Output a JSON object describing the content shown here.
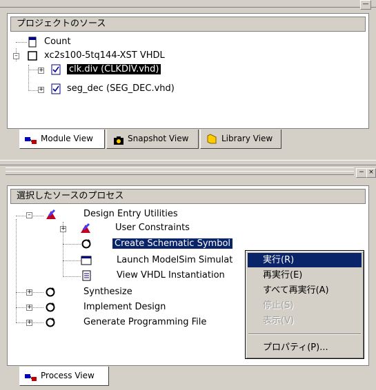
{
  "sources_panel": {
    "header": "プロジェクトのソース",
    "items": [
      {
        "label": "Count"
      },
      {
        "label": "xc2s100-5tq144-XST VHDL"
      },
      {
        "label": "clk.div (CLKDIV.vhd)"
      },
      {
        "label": "seg_dec (SEG_DEC.vhd)"
      }
    ]
  },
  "sources_tabs": [
    {
      "label": "Module View"
    },
    {
      "label": "Snapshot View"
    },
    {
      "label": "Library View"
    }
  ],
  "process_panel": {
    "header": "選択したソースのプロセス",
    "items": [
      {
        "label": "Design Entry Utilities"
      },
      {
        "label": "User Constraints"
      },
      {
        "label": "Create Schematic Symbol"
      },
      {
        "label": "Launch ModelSim Simulat"
      },
      {
        "label": "View VHDL Instantiation"
      },
      {
        "label": "Synthesize"
      },
      {
        "label": "Implement Design"
      },
      {
        "label": "Generate Programming File"
      }
    ]
  },
  "process_tabs": [
    {
      "label": "Process View"
    }
  ],
  "context_menu": {
    "items": [
      {
        "label": "実行(R)",
        "state": "highlighted"
      },
      {
        "label": "再実行(E)",
        "state": "enabled"
      },
      {
        "label": "すべて再実行(A)",
        "state": "enabled"
      },
      {
        "label": "停止(S)",
        "state": "disabled"
      },
      {
        "label": "表示(V)",
        "state": "disabled"
      },
      {
        "label": "プロパティ(P)...",
        "state": "enabled"
      }
    ]
  },
  "colors": {
    "window_bg": "#d4d0c8",
    "selection": "#0a246a",
    "selection_text": "#ffffff"
  }
}
